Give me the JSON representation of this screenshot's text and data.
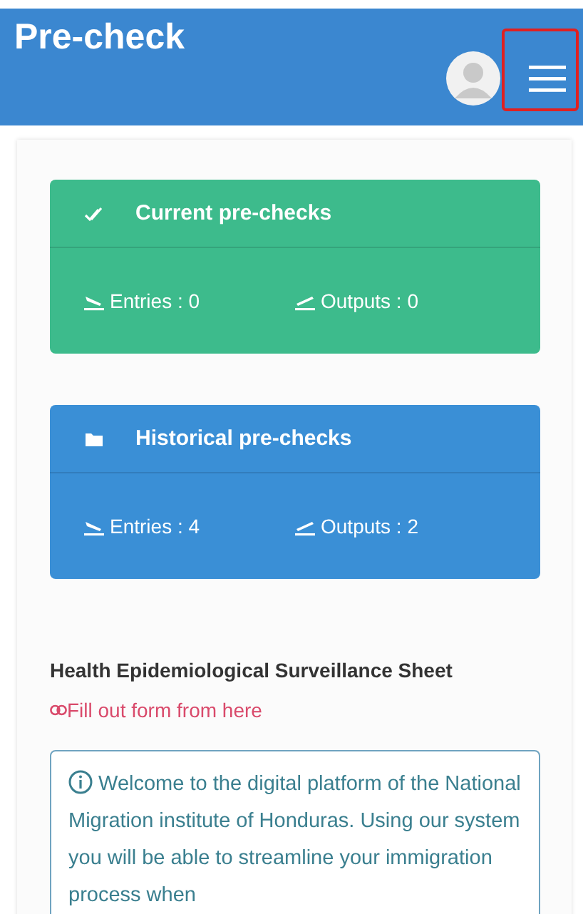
{
  "header": {
    "title": "Pre-check"
  },
  "summary_cards": [
    {
      "kind": "current",
      "title": "Current pre-checks",
      "color": "#3dbb8c",
      "stats": [
        "Entries : 0",
        "Outputs : 0"
      ]
    },
    {
      "kind": "historical",
      "title": "Historical pre-checks",
      "color": "#3a8fd6",
      "stats": [
        "Entries : 4",
        "Outputs : 2"
      ]
    }
  ],
  "health_section": {
    "heading": "Health Epidemiological Surveillance Sheet",
    "link": "Fill out form from here"
  },
  "info_box": {
    "text": "Welcome to the digital platform of the National Migration institute of Honduras. Using our system you will be able to streamline your immigration process when"
  }
}
